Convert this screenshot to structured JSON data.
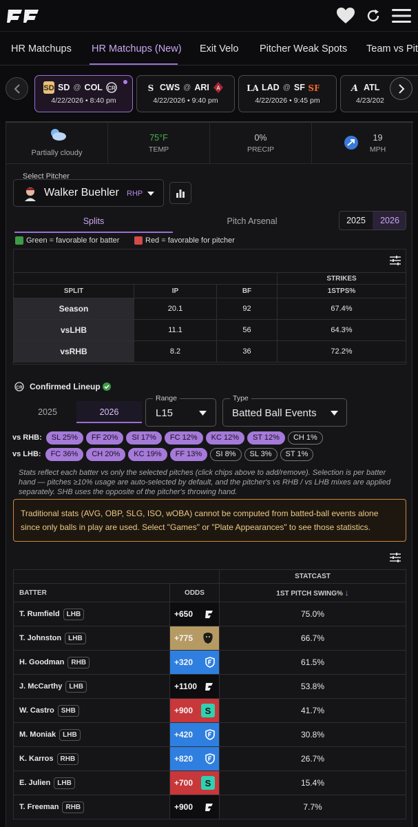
{
  "nav": {
    "tabs": [
      "HR Matchups",
      "HR Matchups (New)",
      "Exit Velo",
      "Pitcher Weak Spots",
      "Team vs Pitc"
    ],
    "active_tab": 1
  },
  "games": [
    {
      "away": "SD",
      "home": "COL",
      "date": "4/22/2026",
      "time": "8:40 pm",
      "selected": true
    },
    {
      "away": "CWS",
      "home": "ARI",
      "date": "4/22/2026",
      "time": "9:40 pm",
      "selected": false
    },
    {
      "away": "LAD",
      "home": "SF",
      "date": "4/22/2026",
      "time": "9:45 pm",
      "selected": false
    },
    {
      "away": "ATL",
      "home": "",
      "date": "4/23/202",
      "time": "",
      "selected": false
    }
  ],
  "game_at": "@",
  "game_sep": "•",
  "weather": {
    "condition": "Partially cloudy",
    "temp_value": "75°F",
    "temp_label": "TEMP",
    "precip_value": "0%",
    "precip_label": "PRECIP",
    "wind_value": "19",
    "wind_label": "MPH"
  },
  "pitcher": {
    "select_label": "Select Pitcher",
    "name": "Walker Buehler",
    "hand": "RHP"
  },
  "view_tabs": {
    "splits": "Splits",
    "arsenal": "Pitch Arsenal"
  },
  "years": [
    "2025",
    "2026"
  ],
  "legend": {
    "green": "Green = favorable for batter",
    "red": "Red = favorable for pitcher"
  },
  "splits_table": {
    "group_header": "STRIKES",
    "headers": [
      "SPLIT",
      "IP",
      "BF",
      "1STPS%"
    ],
    "rows": [
      [
        "Season",
        "20.1",
        "92",
        "67.4%"
      ],
      [
        "vsLHB",
        "11.1",
        "56",
        "64.3%"
      ],
      [
        "vsRHB",
        "8.2",
        "36",
        "72.2%"
      ]
    ]
  },
  "lineup": {
    "title": "Confirmed Lineup",
    "years": [
      "2025",
      "2026"
    ],
    "range_label": "Range",
    "range_value": "L15",
    "type_label": "Type",
    "type_value": "Batted Ball Events",
    "vs_rhb_label": "vs RHB:",
    "vs_rhb_chips": [
      {
        "t": "SL 25%",
        "on": true
      },
      {
        "t": "FF 20%",
        "on": true
      },
      {
        "t": "SI 17%",
        "on": true
      },
      {
        "t": "FC 12%",
        "on": true
      },
      {
        "t": "KC 12%",
        "on": true
      },
      {
        "t": "ST 12%",
        "on": true
      },
      {
        "t": "CH 1%",
        "on": false
      }
    ],
    "vs_lhb_label": "vs LHB:",
    "vs_lhb_chips": [
      {
        "t": "FC 36%",
        "on": true
      },
      {
        "t": "CH 20%",
        "on": true
      },
      {
        "t": "KC 19%",
        "on": true
      },
      {
        "t": "FF 13%",
        "on": true
      },
      {
        "t": "SI 8%",
        "on": false
      },
      {
        "t": "SL 3%",
        "on": false
      },
      {
        "t": "ST 1%",
        "on": false
      }
    ],
    "note": "Stats reflect each batter vs only the selected pitches (click chips above to add/remove). Selection is per batter hand — pitches ≥10% usage are auto-selected by default, and the pitcher's vs RHB / vs LHB mixes are applied separately. SHB uses the opposite of the pitcher's throwing hand.",
    "warning": "Traditional stats (AVG, OBP, SLG, ISO, wOBA) cannot be computed from batted-ball events alone since only balls in play are used. Select \"Games\" or \"Plate Appearances\" to see those statistics."
  },
  "batters_table": {
    "group_header": "STATCAST",
    "headers": [
      "BATTER",
      "ODDS",
      "1ST PITCH SWING%"
    ],
    "rows": [
      {
        "name": "T. Rumfield",
        "hand": "LHB",
        "odds": "+650",
        "book": "sportsbook-a",
        "bg": "#0d0d0f",
        "val": "75.0%"
      },
      {
        "name": "T. Johnston",
        "hand": "LHB",
        "odds": "+775",
        "book": "sportsbook-b",
        "bg": "#b59a63",
        "val": "66.7%"
      },
      {
        "name": "H. Goodman",
        "hand": "RHB",
        "odds": "+320",
        "book": "fanduel",
        "bg": "#2f7fe0",
        "val": "61.5%"
      },
      {
        "name": "J. McCarthy",
        "hand": "LHB",
        "odds": "+1100",
        "book": "sportsbook-a",
        "bg": "#0d0d0f",
        "val": "53.8%"
      },
      {
        "name": "W. Castro",
        "hand": "SHB",
        "odds": "+900",
        "book": "sportsbook-c",
        "bg": "#c8373a",
        "val": "41.7%"
      },
      {
        "name": "M. Moniak",
        "hand": "LHB",
        "odds": "+420",
        "book": "fanduel",
        "bg": "#2f7fe0",
        "val": "30.8%"
      },
      {
        "name": "K. Karros",
        "hand": "RHB",
        "odds": "+820",
        "book": "fanduel",
        "bg": "#2f7fe0",
        "val": "26.7%"
      },
      {
        "name": "E. Julien",
        "hand": "LHB",
        "odds": "+700",
        "book": "sportsbook-c",
        "bg": "#c8373a",
        "val": "15.4%"
      },
      {
        "name": "T. Freeman",
        "hand": "RHB",
        "odds": "+900",
        "book": "sportsbook-a",
        "bg": "#0d0d0f",
        "val": "7.7%"
      }
    ]
  },
  "colors": {
    "accent": "#9b6fd6",
    "chip": "#a57ad9",
    "green": "#3f9a48",
    "red": "#d24b4b",
    "warn_border": "#c98a3a"
  }
}
